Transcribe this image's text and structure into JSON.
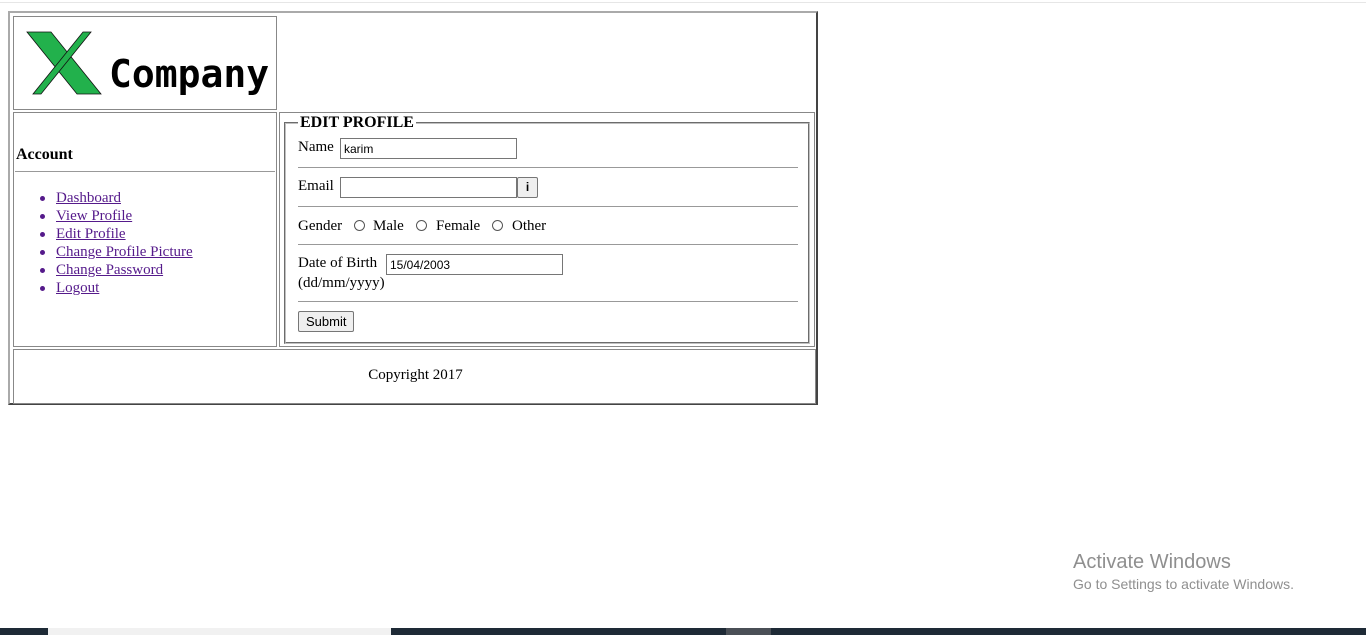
{
  "logo": {
    "text": "Company",
    "mark_color": "#22b14c"
  },
  "nav": {
    "heading": "Account",
    "items": [
      {
        "label": "Dashboard"
      },
      {
        "label": "View Profile"
      },
      {
        "label": "Edit Profile"
      },
      {
        "label": "Change Profile Picture"
      },
      {
        "label": "Change Password"
      },
      {
        "label": "Logout"
      }
    ],
    "link_color": "#551a8b"
  },
  "form": {
    "legend": "EDIT PROFILE",
    "name_label": "Name",
    "name_value": "karim",
    "email_label": "Email",
    "email_value": "",
    "info_button": "i",
    "gender_label": "Gender",
    "gender_options": [
      "Male",
      "Female",
      "Other"
    ],
    "dob_label": "Date of Birth",
    "dob_value": "15/04/2003",
    "dob_hint": "(dd/mm/yyyy)",
    "submit_label": "Submit"
  },
  "footer": {
    "text": "Copyright 2017"
  },
  "watermark": {
    "title": "Activate Windows",
    "subtitle": "Go to Settings to activate Windows."
  }
}
